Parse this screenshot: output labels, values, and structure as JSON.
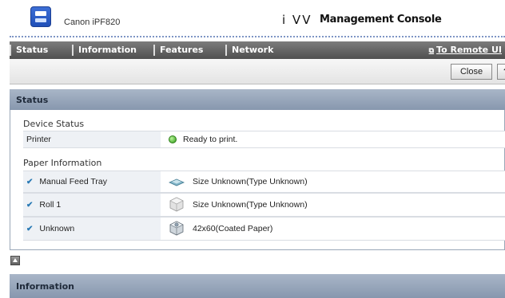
{
  "header": {
    "device_name": "Canon iPF820",
    "console_logo": "i VV",
    "console_title": "Management Console",
    "icon": "printer-icon",
    "accent_color": "#2a5bc9"
  },
  "nav": {
    "tabs": [
      "Status",
      "Information",
      "Features",
      "Network"
    ],
    "remote_link": "To Remote UI",
    "remote_icon": "external-link-icon"
  },
  "toolbar": {
    "close_label": "Close",
    "help_label": "?"
  },
  "status": {
    "title": "Status",
    "device_status_heading": "Device Status",
    "device_rows": [
      {
        "label": "Printer",
        "value": "Ready to print.",
        "icon": "ready-status-icon",
        "status_color": "#3fb020"
      }
    ],
    "paper_heading": "Paper Information",
    "paper_rows": [
      {
        "label": "Manual Feed Tray",
        "value": "Size Unknown(Type Unknown)",
        "icon": "manual-feed-tray-icon"
      },
      {
        "label": "Roll 1",
        "value": "Size Unknown(Type Unknown)",
        "icon": "roll-paper-icon"
      },
      {
        "label": "Unknown",
        "value": "42x60(Coated Paper)",
        "icon": "roll-paper-loaded-icon"
      }
    ]
  },
  "information": {
    "title": "Information"
  }
}
